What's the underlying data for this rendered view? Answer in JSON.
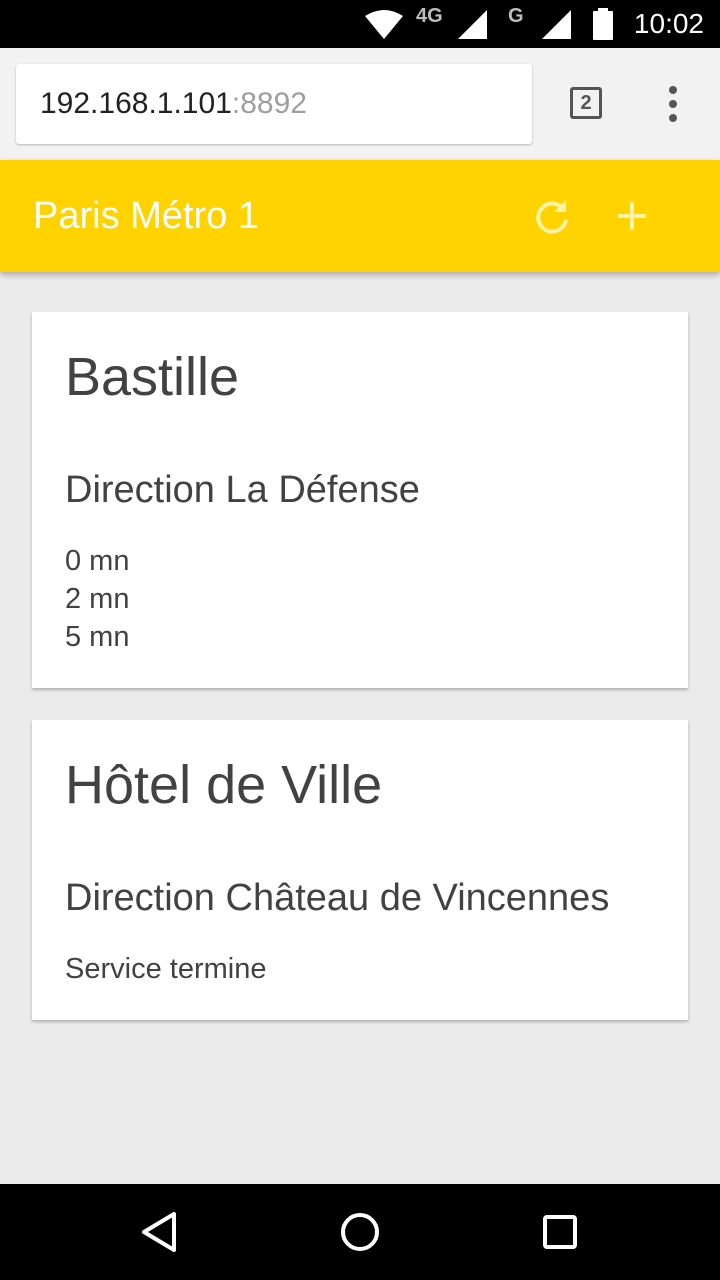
{
  "status_bar": {
    "network_label": "4G",
    "network_label_2": "G",
    "time": "10:02",
    "icons": [
      "wifi-icon",
      "signal-icon",
      "signal-icon",
      "battery-icon"
    ]
  },
  "browser": {
    "url_host": "192.168.1.101",
    "url_port": ":8892",
    "tab_count": "2",
    "menu_icon": "more-vert-icon"
  },
  "app": {
    "title": "Paris Métro 1",
    "accent_color": "#ffd200",
    "actions": [
      "refresh-icon",
      "add-icon"
    ]
  },
  "stations": [
    {
      "name": "Bastille",
      "direction": "Direction La Défense",
      "times": [
        "0 mn",
        "2 mn",
        "5 mn"
      ]
    },
    {
      "name": "Hôtel de Ville",
      "direction": "Direction Château de Vincennes",
      "status": "Service termine"
    }
  ],
  "nav_bar": {
    "buttons": [
      "back-icon",
      "home-icon",
      "recents-icon"
    ]
  }
}
